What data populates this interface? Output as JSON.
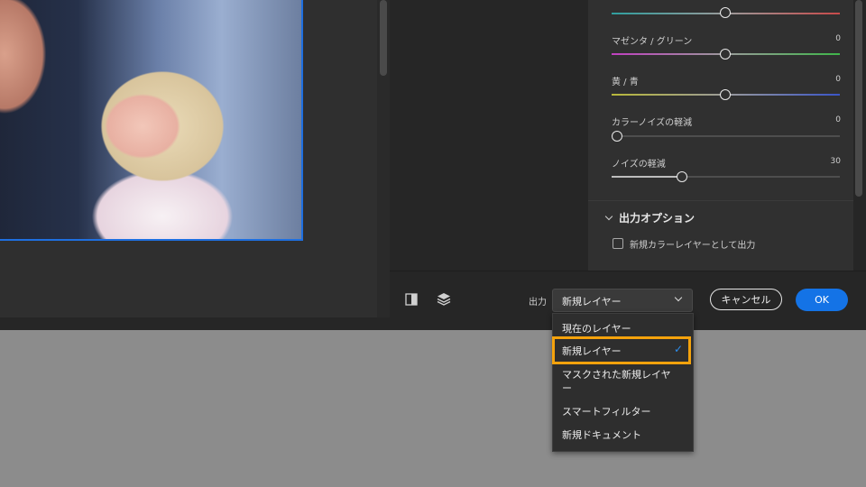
{
  "sliders": [
    {
      "label": "",
      "value": ""
    },
    {
      "label": "マゼンタ / グリーン",
      "value": "0"
    },
    {
      "label": "黄 / 青",
      "value": "0"
    },
    {
      "label": "カラーノイズの軽減",
      "value": "0"
    },
    {
      "label": "ノイズの軽減",
      "value": "30"
    }
  ],
  "output_options": {
    "title": "出力オプション",
    "checkbox_label": "新規カラーレイヤーとして出力"
  },
  "bottom": {
    "output_label": "出力",
    "selected": "新規レイヤー",
    "cancel": "キャンセル",
    "ok": "OK"
  },
  "dropdown": {
    "items": [
      "現在のレイヤー",
      "新規レイヤー",
      "マスクされた新規レイヤー",
      "スマートフィルター",
      "新規ドキュメント"
    ],
    "checkmark": "✓"
  },
  "colors": {
    "accent": "#1473e6",
    "highlight": "#f4a20c"
  }
}
